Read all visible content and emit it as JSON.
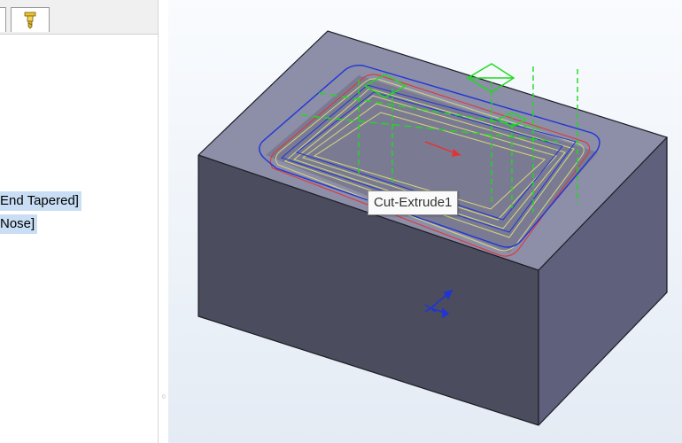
{
  "feature_tree": {
    "items": [
      {
        "label": "End Tapered]"
      },
      {
        "label": "Nose]"
      }
    ]
  },
  "tabs": {
    "tool_icon": "endmill-tool-icon"
  },
  "viewport": {
    "tooltip": "Cut-Extrude1",
    "colors": {
      "block_top": "#8d8ea8",
      "block_front": "#4b4c5e",
      "block_right": "#5f607b",
      "block_edge": "#1c1c24",
      "toolpath_green": "#1ddc1d",
      "toolpath_blue": "#1f35d6",
      "toolpath_yellow": "#d8d87a",
      "toolpath_red": "#e53333"
    }
  }
}
